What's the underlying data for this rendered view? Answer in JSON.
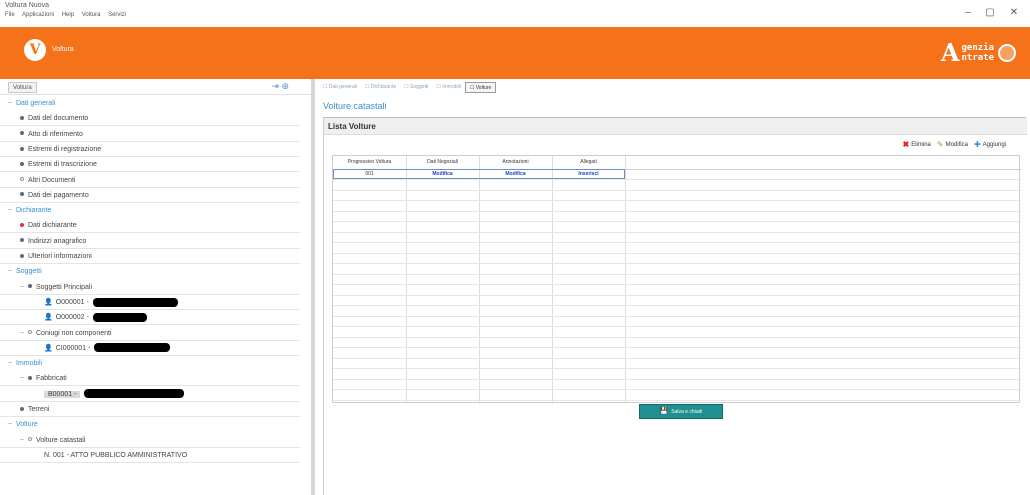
{
  "window": {
    "title": "Voltura Nuova",
    "menu": [
      "File",
      "Applicazioni",
      "Help",
      "Voltura",
      "Servizi"
    ],
    "controls": [
      "–",
      "▢",
      "✕"
    ]
  },
  "header": {
    "app_logo_letter": "V",
    "app_name": "Voltura",
    "agency_letter": "A",
    "agency_line1": "genzia",
    "agency_line2": "ntrate"
  },
  "sidebar": {
    "tab_label": "Voltura",
    "tool_icons": "⇥ ⊕",
    "items": [
      {
        "kind": "section",
        "label": "Dati generali"
      },
      {
        "kind": "item",
        "label": "Dati del documento"
      },
      {
        "kind": "item",
        "label": "Atto di riferimento"
      },
      {
        "kind": "item",
        "label": "Estremi di registrazione"
      },
      {
        "kind": "item",
        "label": "Estremi di trascrizione"
      },
      {
        "kind": "item-hollow",
        "label": "Altri Documenti"
      },
      {
        "kind": "item",
        "label": "Dati dei pagamento"
      },
      {
        "kind": "section",
        "label": "Dichiarante"
      },
      {
        "kind": "item-red",
        "label": "Dati dichiarante"
      },
      {
        "kind": "item",
        "label": "Indirizzi anagrafico"
      },
      {
        "kind": "item",
        "label": "Ulteriori informazioni"
      },
      {
        "kind": "section",
        "label": "Soggetti"
      },
      {
        "kind": "group",
        "label": "Soggetti Principali"
      },
      {
        "kind": "person",
        "label": "O000001 -"
      },
      {
        "kind": "person",
        "label": "O000002 -"
      },
      {
        "kind": "group-hollow",
        "label": "Coniugi non componenti"
      },
      {
        "kind": "person",
        "label": "CI000001 -"
      },
      {
        "kind": "section",
        "label": "Immobili"
      },
      {
        "kind": "group",
        "label": "Fabbricati"
      },
      {
        "kind": "building",
        "label": "B00001 -"
      },
      {
        "kind": "item",
        "label": "Terreni"
      },
      {
        "kind": "section",
        "label": "Volture"
      },
      {
        "kind": "group-hollow",
        "label": "Volture catastali"
      },
      {
        "kind": "plain",
        "label": "N. 001 - ATTO PUBBLICO AMMINISTRATIVO"
      }
    ]
  },
  "main": {
    "tabs": [
      "Dati generali",
      "Dichiarante",
      "Soggetti",
      "Immobili",
      "Volture"
    ],
    "active_tab_index": 4,
    "page_title": "Volture catastali",
    "box_title": "Lista Volture",
    "actions": {
      "delete_icon": "✖",
      "delete_label": "Elimina",
      "edit_icon": "✎",
      "edit_label": "Modifica",
      "add_icon": "✚",
      "add_label": "Aggiungi"
    },
    "grid": {
      "columns": [
        "Progressivo Voltura",
        "Dati Negoziali",
        "Annotazioni",
        "Allegati"
      ],
      "rows": [
        [
          "001",
          "Modifica",
          "Modifica",
          "Inserisci"
        ]
      ]
    },
    "save_button": {
      "icon": "💾",
      "label": "Salva e chiudi"
    }
  }
}
